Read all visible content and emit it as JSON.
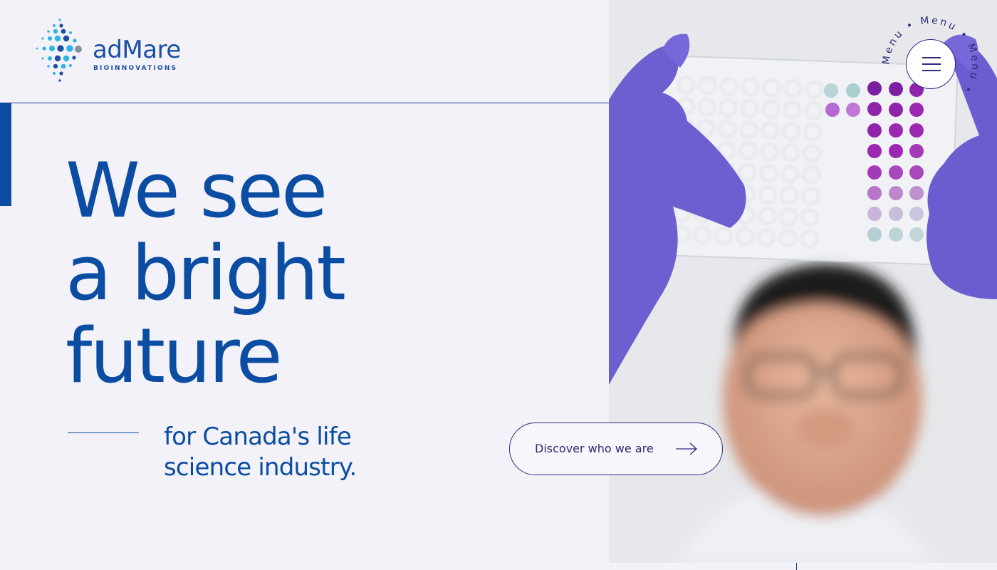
{
  "brand": {
    "name": "adMare",
    "tagline": "BIOINNOVATIONS",
    "colors": {
      "primary": "#0b4da2",
      "dark": "#2d2a7a",
      "cyan": "#2fb3e6",
      "grey": "#8a8f99"
    }
  },
  "hero": {
    "headline_lines": [
      "We see",
      "a bright",
      "future"
    ],
    "subline_lines": [
      "for Canada's life",
      "science industry."
    ],
    "cta_label": "Discover who we are",
    "cta_icon": "arrow-right-icon"
  },
  "menu": {
    "ring_text": "Menu • Menu • Menu •",
    "icon": "hamburger-icon"
  },
  "photo": {
    "subject": "scientist-holding-well-plate"
  }
}
